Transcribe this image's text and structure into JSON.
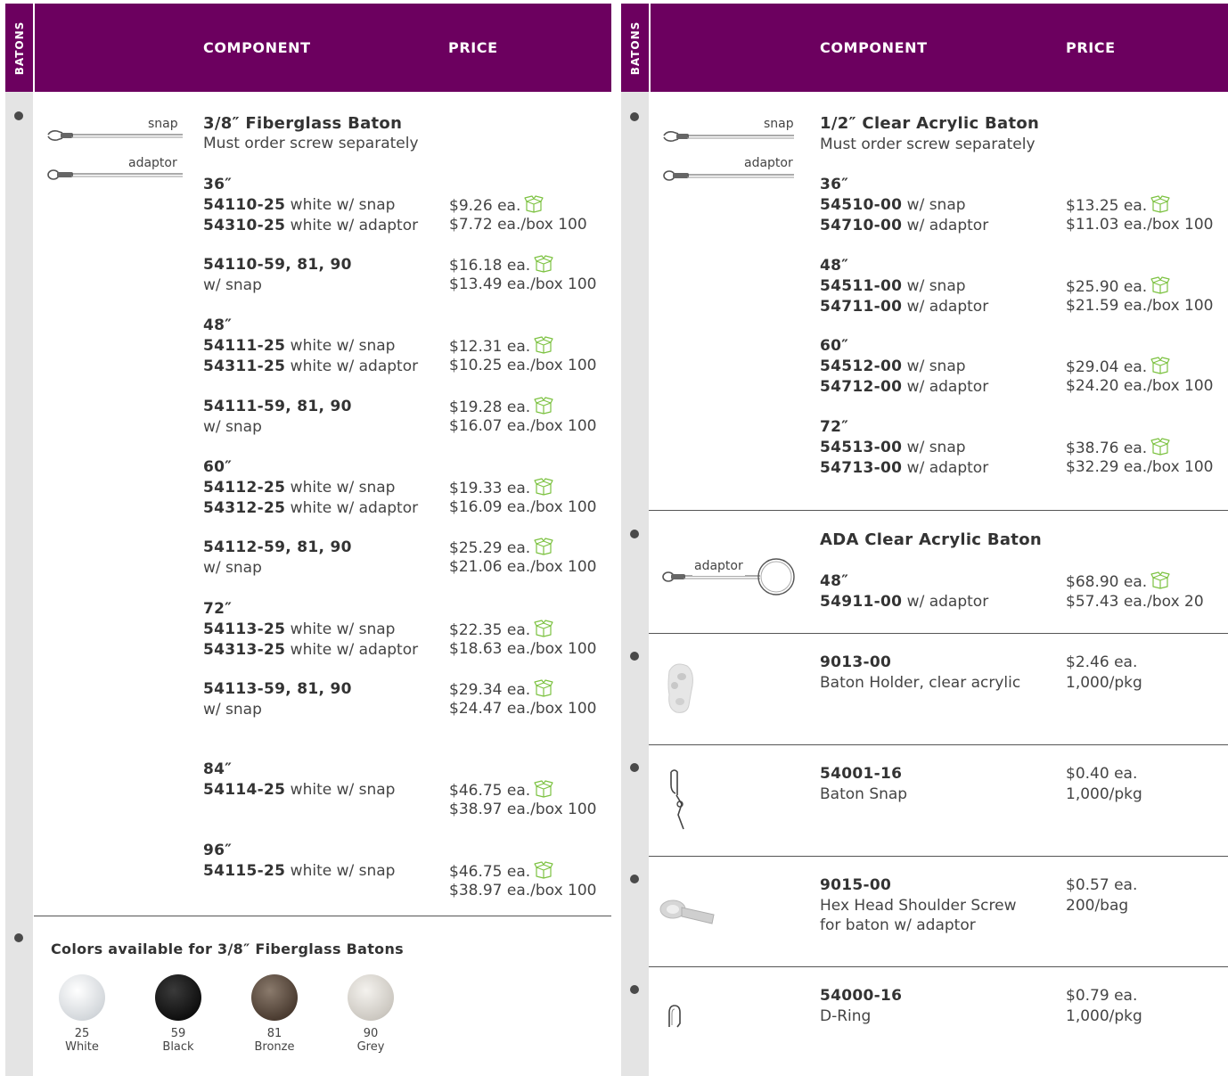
{
  "tab_label": "BATONS",
  "headers": {
    "component": "COMPONENT",
    "price": "PRICE"
  },
  "icons": {
    "new_box": "open-box-icon",
    "accent": "#7dc242",
    "header_color": "#6c005f"
  },
  "left": {
    "img_labels": {
      "snap": "snap",
      "adaptor": "adaptor"
    },
    "title": "3/8″ Fiberglass Baton",
    "subtitle": "Must order screw separately",
    "rows": [
      {
        "size": "36″",
        "l1b": "54110-25",
        "l1": " white w/ snap",
        "l2b": "54310-25",
        "l2": " white w/ adaptor",
        "p1": "$9.26 ea.",
        "p2": "$7.72 ea./box 100"
      },
      {
        "l1b": "54110-59, 81, 90",
        "l1": "",
        "l2b": "",
        "l2": "w/ snap",
        "p1": "$16.18 ea.",
        "p2": "$13.49 ea./box 100"
      },
      {
        "size": "48″",
        "l1b": "54111-25",
        "l1": " white w/ snap",
        "l2b": "54311-25",
        "l2": " white w/ adaptor",
        "p1": "$12.31 ea.",
        "p2": "$10.25 ea./box 100"
      },
      {
        "l1b": "54111-59, 81, 90",
        "l1": "",
        "l2b": "",
        "l2": "w/ snap",
        "p1": "$19.28 ea.",
        "p2": "$16.07 ea./box 100"
      },
      {
        "size": "60″",
        "l1b": "54112-25",
        "l1": " white w/ snap",
        "l2b": "54312-25",
        "l2": " white w/ adaptor",
        "p1": "$19.33 ea.",
        "p2": "$16.09 ea./box 100"
      },
      {
        "l1b": "54112-59, 81, 90",
        "l1": "",
        "l2b": "",
        "l2": "w/ snap",
        "p1": "$25.29 ea.",
        "p2": "$21.06 ea./box 100"
      },
      {
        "size": "72″",
        "l1b": "54113-25",
        "l1": " white w/ snap",
        "l2b": "54313-25",
        "l2": " white w/ adaptor",
        "p1": "$22.35 ea.",
        "p2": "$18.63 ea./box 100"
      },
      {
        "l1b": "54113-59, 81, 90",
        "l1": "",
        "l2b": "",
        "l2": "w/ snap",
        "p1": "$29.34 ea.",
        "p2": "$24.47 ea./box 100"
      },
      {
        "size": "84″",
        "l1b": "54114-25",
        "l1": " white w/ snap",
        "p1": "$46.75 ea.",
        "p2": "$38.97 ea./box 100"
      },
      {
        "size": "96″",
        "l1b": "54115-25",
        "l1": " white w/ snap",
        "p1": "$46.75 ea.",
        "p2": "$38.97 ea./box 100"
      }
    ],
    "colors_title": "Colors available for 3/8″ Fiberglass Batons",
    "swatches": [
      {
        "code": "25",
        "name": "White"
      },
      {
        "code": "59",
        "name": "Black"
      },
      {
        "code": "81",
        "name": "Bronze"
      },
      {
        "code": "90",
        "name": "Grey"
      }
    ]
  },
  "right": {
    "img_labels": {
      "snap": "snap",
      "adaptor": "adaptor",
      "ada_adaptor": "adaptor"
    },
    "acrylic": {
      "title": "1/2″ Clear Acrylic Baton",
      "subtitle": "Must order screw separately",
      "rows": [
        {
          "size": "36″",
          "l1b": "54510-00",
          "l1": " w/ snap",
          "l2b": "54710-00",
          "l2": " w/ adaptor",
          "p1": "$13.25 ea.",
          "p2": "$11.03 ea./box 100"
        },
        {
          "size": "48″",
          "l1b": "54511-00",
          "l1": " w/ snap",
          "l2b": "54711-00",
          "l2": " w/ adaptor",
          "p1": "$25.90 ea.",
          "p2": "$21.59 ea./box 100"
        },
        {
          "size": "60″",
          "l1b": "54512-00",
          "l1": " w/ snap",
          "l2b": "54712-00",
          "l2": " w/ adaptor",
          "p1": "$29.04 ea.",
          "p2": "$24.20 ea./box 100"
        },
        {
          "size": "72″",
          "l1b": "54513-00",
          "l1": " w/ snap",
          "l2b": "54713-00",
          "l2": " w/ adaptor",
          "p1": "$38.76 ea.",
          "p2": "$32.29 ea./box 100"
        }
      ]
    },
    "ada": {
      "title": "ADA Clear Acrylic Baton",
      "size": "48″",
      "l1b": "54911-00",
      "l1": " w/ adaptor",
      "p1": "$68.90 ea.",
      "p2": "$57.43 ea./box 20"
    },
    "parts": [
      {
        "code": "9013-00",
        "desc": "Baton Holder, clear acrylic",
        "p1": "$2.46 ea.",
        "p2": "1,000/pkg"
      },
      {
        "code": "54001-16",
        "desc": "Baton Snap",
        "p1": "$0.40 ea.",
        "p2": "1,000/pkg"
      },
      {
        "code": "9015-00",
        "desc": "Hex Head Shoulder Screw",
        "desc2": "for baton w/ adaptor",
        "p1": "$0.57 ea.",
        "p2": "200/bag"
      },
      {
        "code": "54000-16",
        "desc": "D-Ring",
        "p1": "$0.79 ea.",
        "p2": "1,000/pkg"
      }
    ]
  }
}
